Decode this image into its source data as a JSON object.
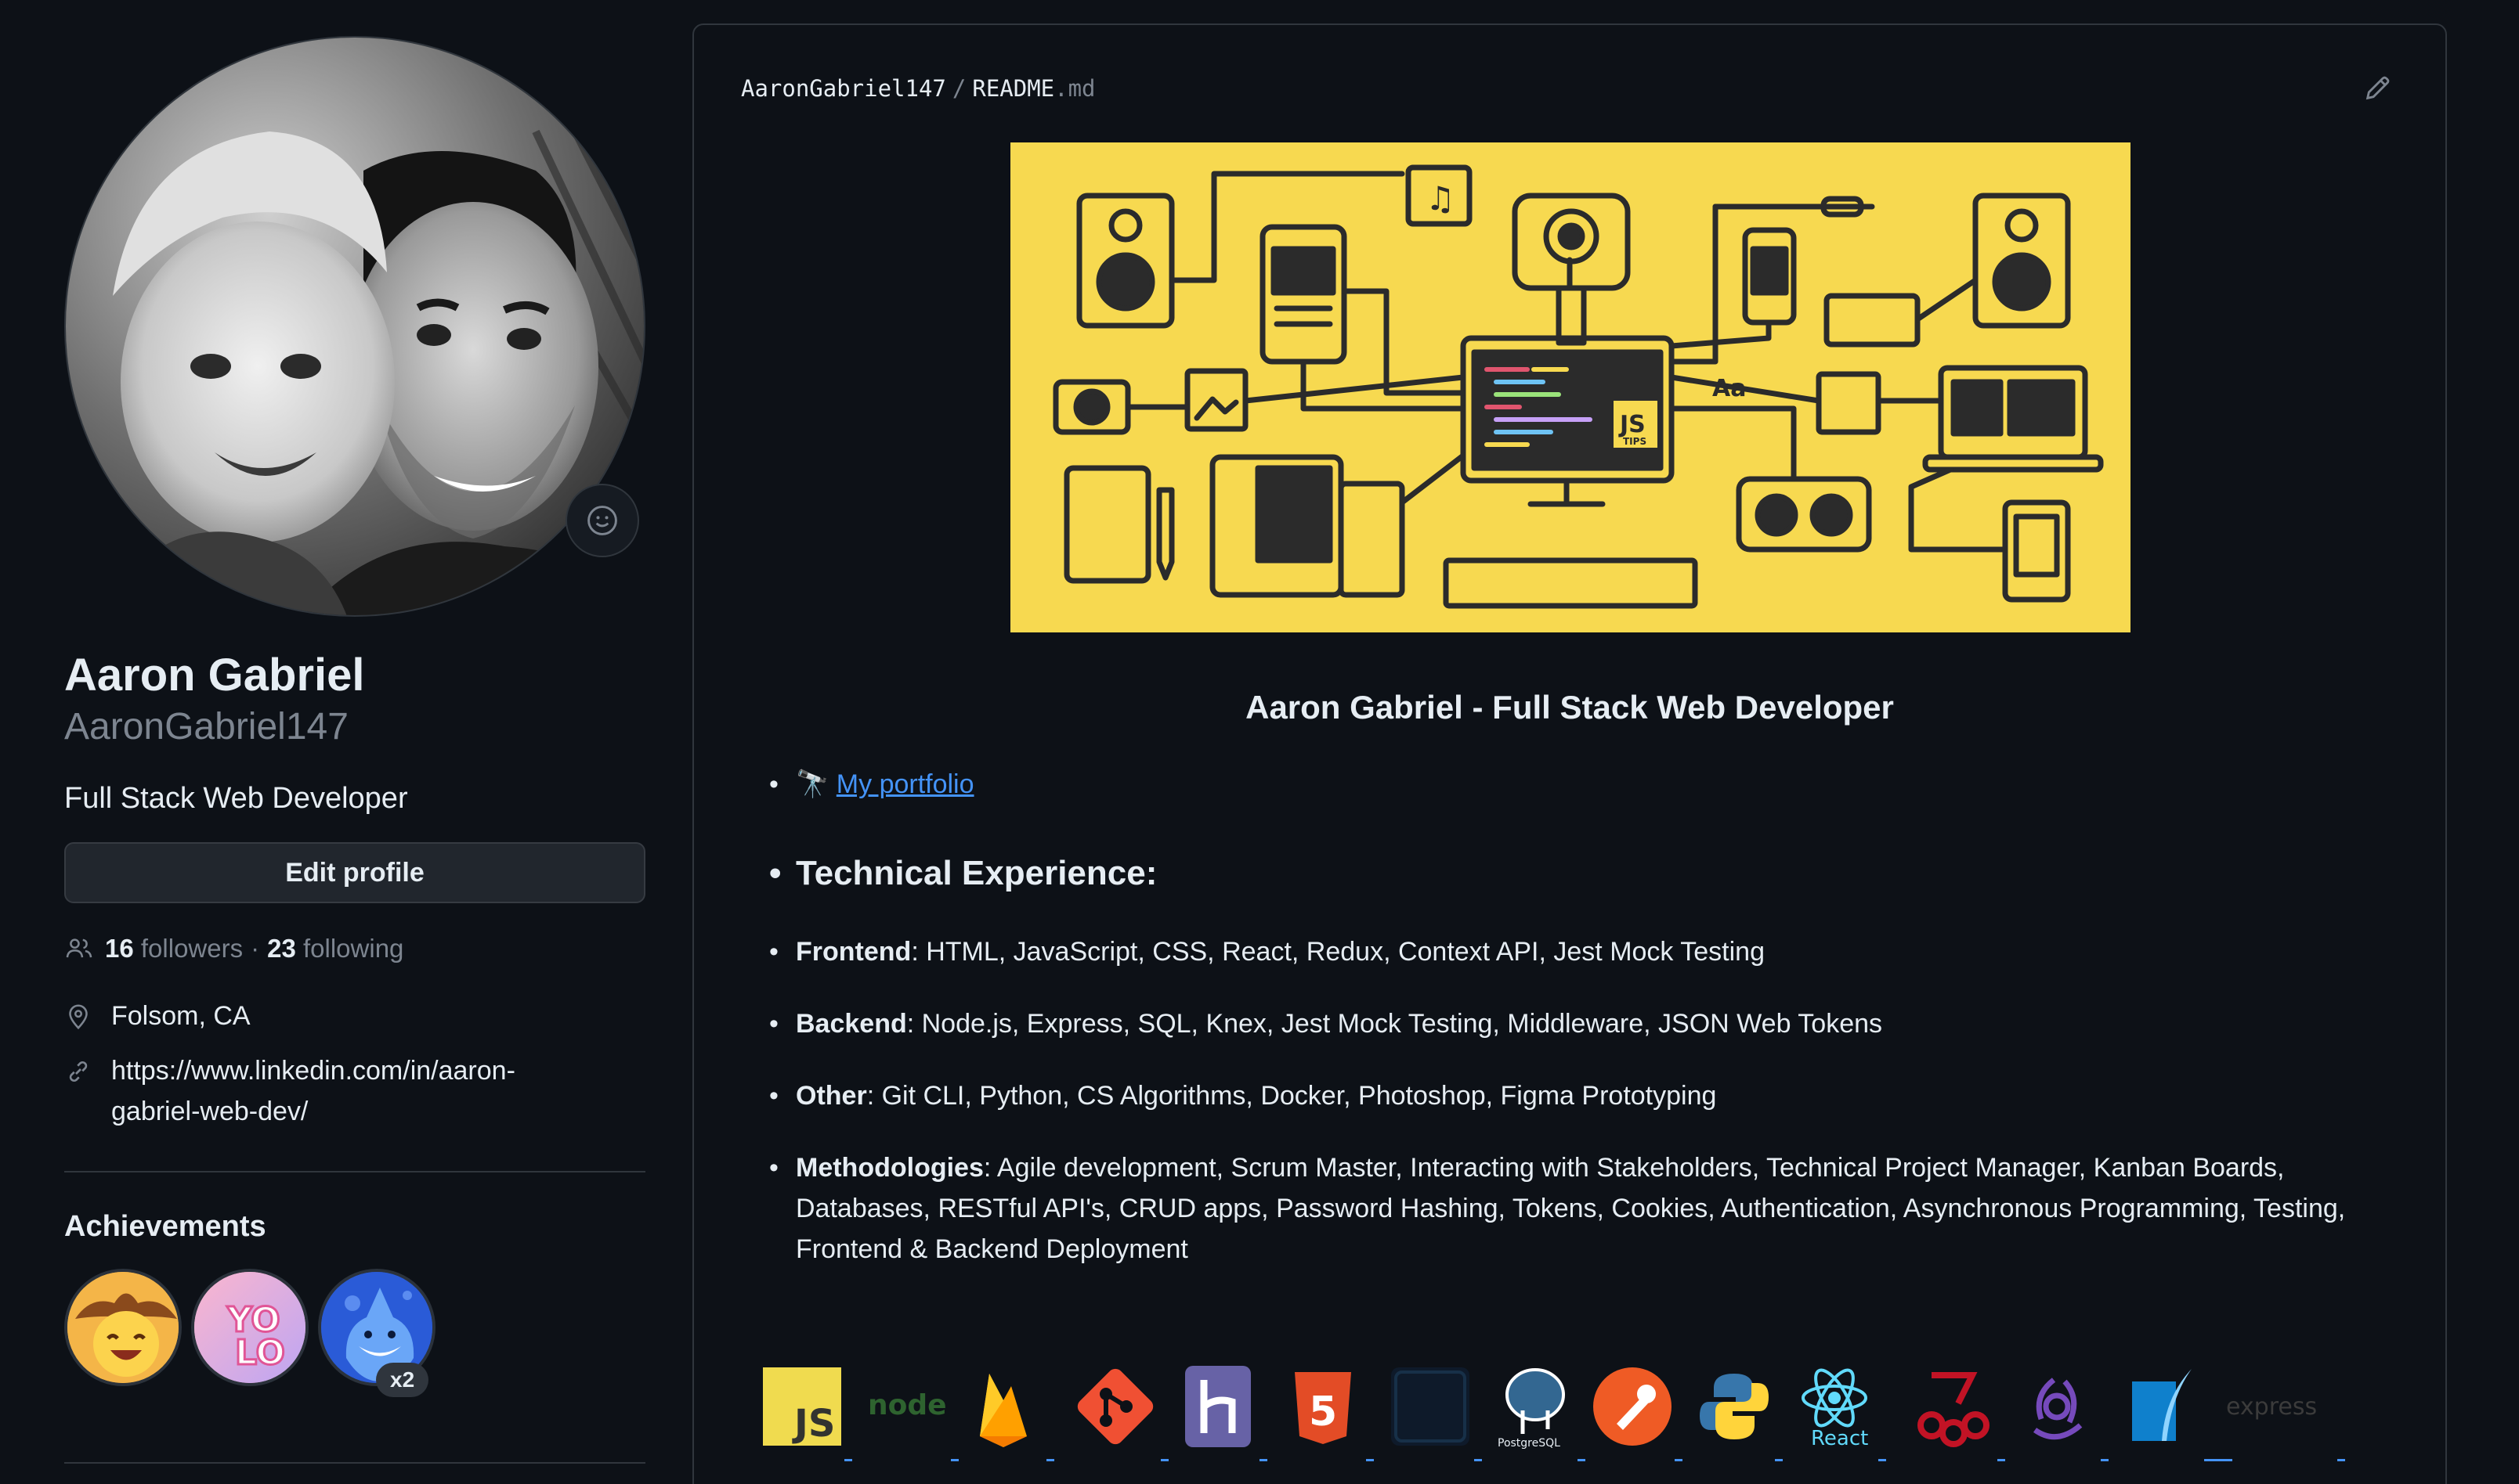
{
  "profile": {
    "name": "Aaron Gabriel",
    "login": "AaronGabriel147",
    "bio": "Full Stack Web Developer",
    "edit_label": "Edit profile",
    "followers_count": "16",
    "followers_label": "followers",
    "separator": "·",
    "following_count": "23",
    "following_label": "following",
    "location": "Folsom, CA",
    "website_line1": "https://www.linkedin.com/in/aaron-",
    "website_line2": "gabriel-web-dev/"
  },
  "achievements": {
    "title": "Achievements",
    "items": [
      {
        "icon": "cowboy-emoji-badge"
      },
      {
        "icon": "yolo-badge"
      },
      {
        "icon": "shark-badge",
        "multiplier": "x2"
      }
    ]
  },
  "readme": {
    "owner": "AaronGabriel147",
    "separator": "/",
    "file_base": "README",
    "file_ext": ".md",
    "heading": "Aaron Gabriel - Full Stack Web Developer",
    "portfolio_emoji": "🔭",
    "portfolio_link": "My portfolio",
    "tech_heading": "Technical Experience:",
    "frontend_label": "Frontend",
    "frontend_text": ": HTML, JavaScript, CSS, React, Redux, Context API, Jest Mock Testing",
    "backend_label": "Backend",
    "backend_text": ": Node.js, Express, SQL, Knex, Jest Mock Testing, Middleware, JSON Web Tokens",
    "other_label": "Other",
    "other_text": ": Git CLI, Python, CS Algorithms, Docker, Photoshop, Figma Prototyping",
    "method_label": "Methodologies",
    "method_text": ": Agile development, Scrum Master, Interacting with Stakeholders, Technical Project Manager, Kanban Boards, Databases, RESTful API's, CRUD apps, Password Hashing, Tokens, Cookies, Authentication, Asynchronous Programming, Testing, Frontend & Backend Deployment",
    "banner_js_label": "JS",
    "banner_tips_label": "TIPS",
    "banner_aa_label": "Aa",
    "logos": {
      "js": "JS",
      "node": "node",
      "html_num": "5",
      "postgres": "PostgreSQL",
      "react": "React",
      "express": "express"
    }
  },
  "colors": {
    "background": "#0d1117",
    "text": "#e6edf3",
    "muted": "#7d8590",
    "link": "#4493f8",
    "border": "#30363d",
    "banner": "#f7d950"
  }
}
